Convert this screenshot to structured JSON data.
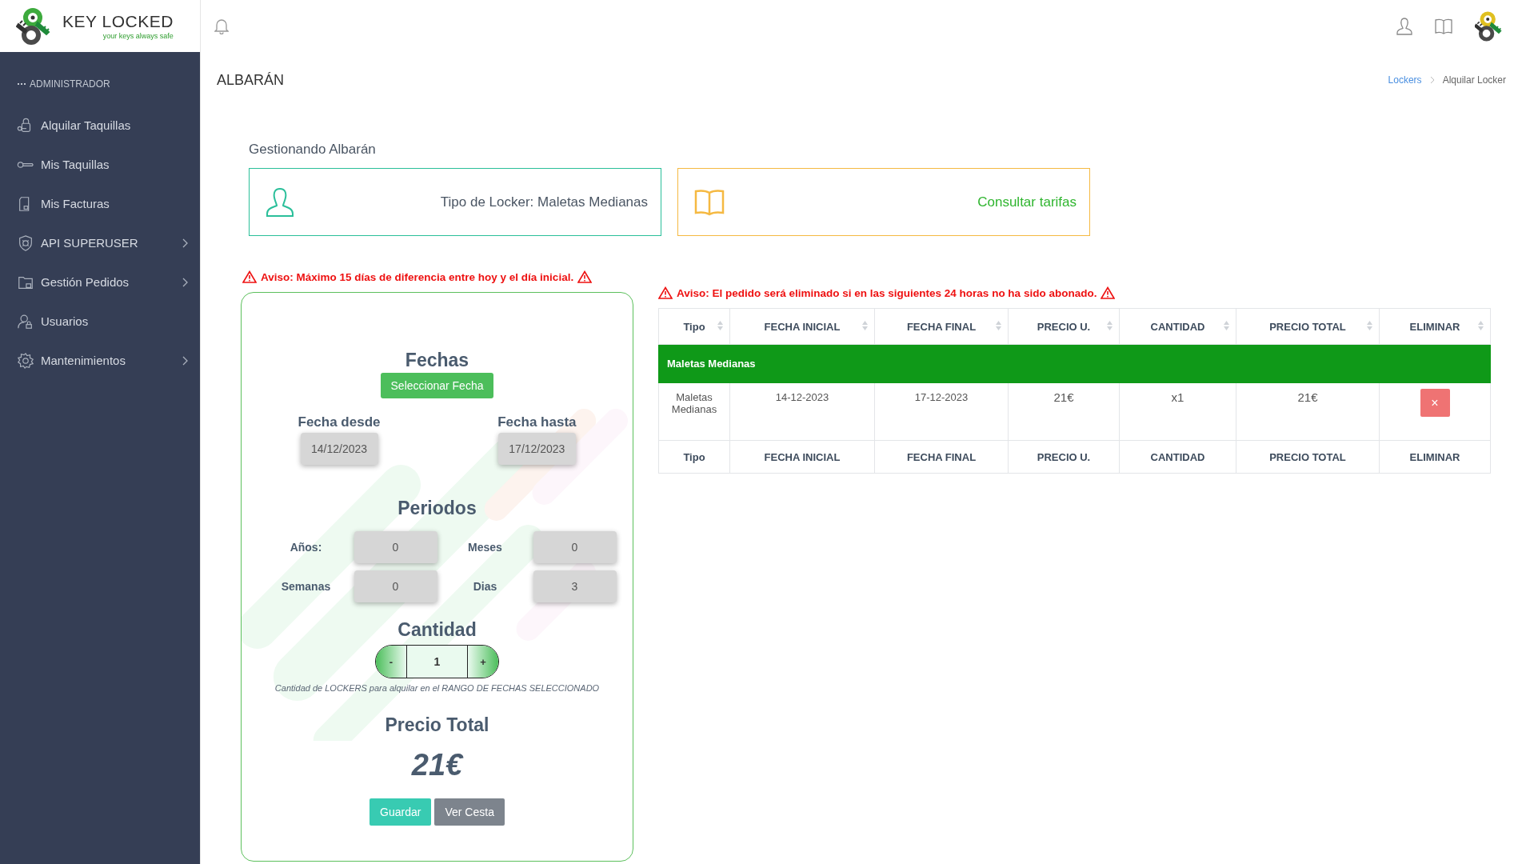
{
  "logo": {
    "name": "KEY LOCKED",
    "tagline": "your keys always safe"
  },
  "sidebar": {
    "section": "ADMINISTRADOR",
    "items": [
      {
        "label": "Alquilar Taquillas",
        "has_submenu": false
      },
      {
        "label": "Mis Taquillas",
        "has_submenu": false
      },
      {
        "label": "Mis Facturas",
        "has_submenu": false
      },
      {
        "label": "API SUPERUSER",
        "has_submenu": true
      },
      {
        "label": "Gestión Pedidos",
        "has_submenu": true
      },
      {
        "label": "Usuarios",
        "has_submenu": false
      },
      {
        "label": "Mantenimientos",
        "has_submenu": true
      }
    ]
  },
  "page": {
    "title": "ALBARÁN",
    "breadcrumb": [
      {
        "label": "Lockers",
        "link": true
      },
      {
        "label": "Alquilar Locker",
        "link": false
      }
    ]
  },
  "heading": "Gestionando Albarán",
  "info_cards": [
    {
      "kind": "locker",
      "text": "Tipo de Locker: Maletas Medianas"
    },
    {
      "kind": "rates",
      "text": "Consultar tarifas"
    }
  ],
  "form": {
    "warning": "Aviso: Máximo 15 días de diferencia entre hoy y el día inicial.",
    "dates_title": "Fechas",
    "select_button": "Seleccionar Fecha",
    "dates": [
      {
        "label": "Fecha desde",
        "value": "14/12/2023"
      },
      {
        "label": "Fecha hasta",
        "value": "17/12/2023"
      }
    ],
    "periods_title": "Periodos",
    "periods": [
      {
        "label": "Años:",
        "value": "0"
      },
      {
        "label": "Meses",
        "value": "0"
      },
      {
        "label": "Semanas",
        "value": "0"
      },
      {
        "label": "Dias",
        "value": "3"
      }
    ],
    "quantity_title": "Cantidad",
    "decrement": "-",
    "quantity": "1",
    "increment": "+",
    "quantity_hint": "Cantidad de LOCKERS para alquilar en el RANGO DE FECHAS SELECCIONADO",
    "total_title": "Precio Total",
    "total": "21€",
    "buttons": [
      {
        "kind": "primary",
        "label": "Guardar"
      },
      {
        "kind": "secondary",
        "label": "Ver Cesta"
      }
    ]
  },
  "order": {
    "warning": "Aviso: El pedido será eliminado si en las siguientes 24 horas no ha sido abonado.",
    "columns": [
      {
        "label": "Tipo",
        "sortable": true
      },
      {
        "label": "FECHA INICIAL",
        "sortable": true
      },
      {
        "label": "FECHA FINAL",
        "sortable": true
      },
      {
        "label": "PRECIO U.",
        "sortable": true
      },
      {
        "label": "CANTIDAD",
        "sortable": true
      },
      {
        "label": "PRECIO TOTAL",
        "sortable": true
      },
      {
        "label": "ELIMINAR",
        "sortable": true
      }
    ],
    "group": "Maletas Medianas",
    "rows": [
      {
        "cells": [
          "Maletas Medianas",
          "14-12-2023",
          "17-12-2023",
          "21€",
          "x1",
          "21€"
        ],
        "delete": "×"
      }
    ],
    "footer": [
      "Tipo",
      "FECHA INICIAL",
      "FECHA FINAL",
      "PRECIO U.",
      "CANTIDAD",
      "PRECIO TOTAL",
      "ELIMINAR"
    ]
  }
}
